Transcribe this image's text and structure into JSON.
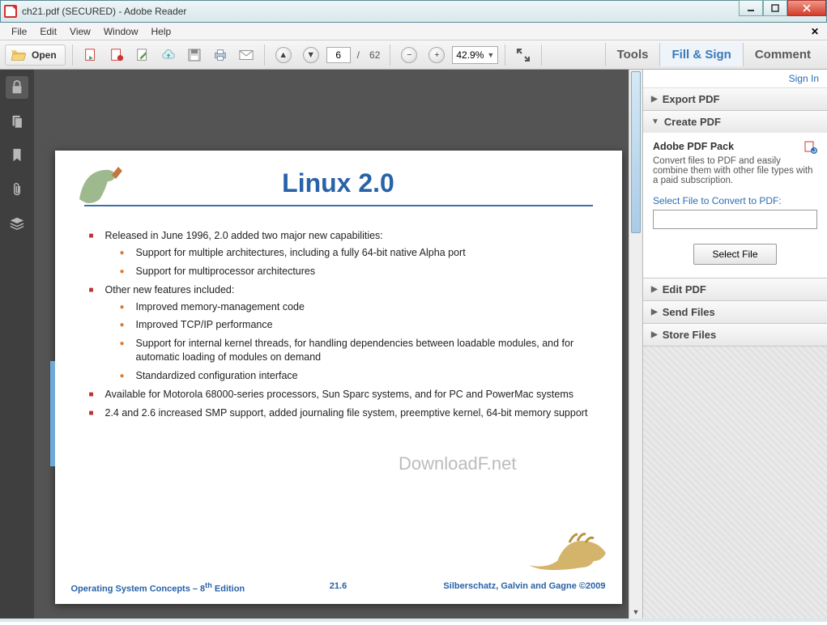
{
  "window": {
    "title": "ch21.pdf (SECURED) - Adobe Reader"
  },
  "menu": {
    "items": [
      "File",
      "Edit",
      "View",
      "Window",
      "Help"
    ]
  },
  "toolbar": {
    "open": "Open",
    "page_current": "6",
    "page_sep": "/",
    "page_total": "62",
    "zoom": "42.9%",
    "tabs": {
      "tools": "Tools",
      "fillsign": "Fill & Sign",
      "comment": "Comment"
    }
  },
  "rightpanel": {
    "signin": "Sign In",
    "export": "Export PDF",
    "create": "Create PDF",
    "pack_title": "Adobe PDF Pack",
    "pack_desc": "Convert files to PDF and easily combine them with other file types with a paid subscription.",
    "select_label": "Select File to Convert to PDF:",
    "select_btn": "Select File",
    "edit": "Edit PDF",
    "send": "Send Files",
    "store": "Store Files"
  },
  "document": {
    "title": "Linux 2.0",
    "bullets": [
      {
        "t": "Released in June 1996,  2.0 added two major new capabilities:",
        "sub": [
          "Support for multiple architectures, including a fully 64-bit native Alpha port",
          "Support for multiprocessor architectures"
        ]
      },
      {
        "t": "Other new features included:",
        "sub": [
          "Improved memory-management code",
          "Improved TCP/IP performance",
          "Support for internal kernel threads, for handling dependencies between loadable modules, and for automatic loading of modules on demand",
          "Standardized configuration interface"
        ]
      },
      {
        "t": "Available for Motorola 68000-series processors, Sun Sparc systems, and for PC and PowerMac systems"
      },
      {
        "t": "2.4 and 2.6 increased SMP support, added journaling file system, preemptive kernel, 64-bit memory support"
      }
    ],
    "footer_left": "Operating System Concepts – 8",
    "footer_left_sup": "th",
    "footer_left_tail": " Edition",
    "footer_center": "21.6",
    "footer_right": "Silberschatz, Galvin and Gagne ©2009",
    "watermark": "DownloadF.net"
  }
}
